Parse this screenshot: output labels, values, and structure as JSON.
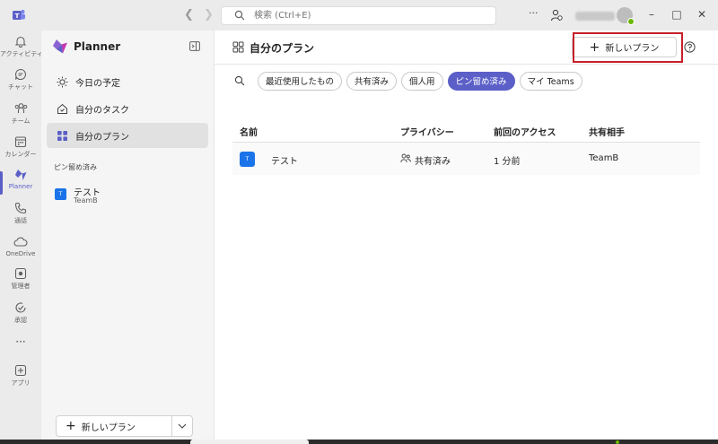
{
  "titlebar": {
    "search_placeholder": "検索 (Ctrl+E)",
    "more_label": "···"
  },
  "rail": {
    "items": [
      {
        "label": "アクティビティ",
        "icon": "bell-icon"
      },
      {
        "label": "チャット",
        "icon": "chat-icon"
      },
      {
        "label": "チーム",
        "icon": "teams-icon"
      },
      {
        "label": "カレンダー",
        "icon": "calendar-icon"
      },
      {
        "label": "Planner",
        "icon": "planner-icon",
        "active": true
      },
      {
        "label": "通話",
        "icon": "phone-icon"
      },
      {
        "label": "OneDrive",
        "icon": "cloud-icon"
      },
      {
        "label": "管理者",
        "icon": "admin-icon"
      },
      {
        "label": "承認",
        "icon": "approval-icon"
      },
      {
        "label": "アプリ",
        "icon": "apps-icon"
      }
    ],
    "more_label": "···"
  },
  "sidebar": {
    "app_name": "Planner",
    "nav": [
      {
        "label": "今日の予定",
        "icon": "sun-icon"
      },
      {
        "label": "自分のタスク",
        "icon": "home-icon"
      },
      {
        "label": "自分のプラン",
        "icon": "grid-icon",
        "active": true
      }
    ],
    "pinned_section_title": "ピン留め済み",
    "pinned_plan": {
      "title": "テスト",
      "subtitle": "TeamB",
      "badge": "T"
    },
    "new_plan_label": "新しいプラン"
  },
  "main": {
    "title": "自分のプラン",
    "new_plan_label": "新しいプラン",
    "filters": [
      {
        "label": "最近使用したもの"
      },
      {
        "label": "共有済み"
      },
      {
        "label": "個人用"
      },
      {
        "label": "ピン留め済み",
        "active": true
      },
      {
        "label": "マイ Teams"
      }
    ],
    "table": {
      "headers": [
        "名前",
        "プライバシー",
        "前回のアクセス",
        "共有相手"
      ],
      "rows": [
        {
          "badge": "T",
          "name": "テスト",
          "privacy": "共有済み",
          "last_access": "1 分前",
          "shared_with": "TeamB"
        }
      ]
    }
  },
  "colors": {
    "accent": "#5b5fc7",
    "highlight": "#c7202a",
    "plan_badge": "#1a73e8",
    "presence": "#6bb700"
  }
}
